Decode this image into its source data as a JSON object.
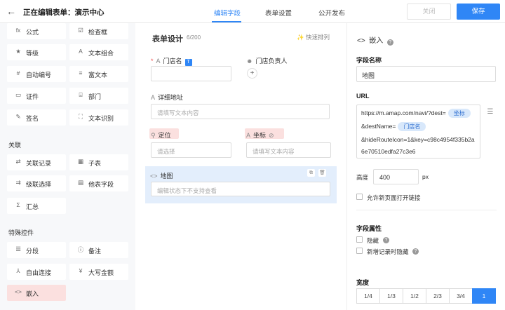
{
  "header": {
    "back_icon": "arrow-left-icon",
    "title": "正在编辑表单：演示中心",
    "tabs": [
      "编辑字段",
      "表单设置",
      "公开发布"
    ],
    "active_tab": 0,
    "close_label": "关闭",
    "save_label": "保存",
    "accent": "#2f86f6"
  },
  "left_panel": {
    "top_items": [
      {
        "icon": "fx",
        "label": "公式"
      },
      {
        "icon": "☑",
        "label": "检查框"
      },
      {
        "icon": "★",
        "label": "等级"
      },
      {
        "icon": "A",
        "label": "文本组合"
      },
      {
        "icon": "#",
        "label": "自动编号"
      },
      {
        "icon": "≡",
        "label": "富文本"
      },
      {
        "icon": "▭",
        "label": "证件"
      },
      {
        "icon": "⌸",
        "label": "部门"
      },
      {
        "icon": "✎",
        "label": "签名"
      },
      {
        "icon": "⛶",
        "label": "文本识别"
      }
    ],
    "section_relation": "关联",
    "relation_items": [
      {
        "icon": "⇄",
        "label": "关联记录"
      },
      {
        "icon": "▦",
        "label": "子表"
      },
      {
        "icon": "⇉",
        "label": "级联选择"
      },
      {
        "icon": "▤",
        "label": "他表字段"
      },
      {
        "icon": "Σ",
        "label": "汇总"
      }
    ],
    "section_special": "特殊控件",
    "special_items": [
      {
        "icon": "☰",
        "label": "分段"
      },
      {
        "icon": "ⓘ",
        "label": "备注"
      },
      {
        "icon": "⅄",
        "label": "自由连接"
      },
      {
        "icon": "¥",
        "label": "大写金额"
      },
      {
        "icon": "<>",
        "label": "嵌入"
      }
    ]
  },
  "canvas": {
    "title": "表单设计",
    "count": "6/200",
    "quick_sort": "快速排列",
    "fields": {
      "store_name": {
        "label": "门店名",
        "badge": "T"
      },
      "store_owner": {
        "label": "门店负责人",
        "add": "+"
      },
      "address": {
        "label": "详细地址",
        "placeholder": "请填写文本内容"
      },
      "location": {
        "label": "定位",
        "placeholder": "请选择"
      },
      "coords": {
        "label": "坐标",
        "placeholder": "请填写文本内容"
      },
      "map": {
        "label": "地图",
        "placeholder": "编辑状态下不支持查看"
      }
    }
  },
  "props": {
    "head": "嵌入",
    "field_name_label": "字段名称",
    "field_name_value": "地图",
    "url_label": "URL",
    "url_parts": {
      "line1": "https://m.amap.com/navi/?dest=",
      "chip1": "坐标",
      "line2": "&destName=",
      "chip2": "门店名",
      "line3": "&hideRouteIcon=1&key=c98c4954f335b2a",
      "line4": "6e70510edfa27c3e6"
    },
    "height_label": "高度",
    "height_value": "400",
    "height_unit": "px",
    "allow_new_page": "允许新页面打开链接",
    "attr_label": "字段属性",
    "hidden": "隐藏",
    "hide_on_new": "新增记录时隐藏",
    "width_label": "宽度",
    "width_options": [
      "1/4",
      "1/3",
      "1/2",
      "2/3",
      "3/4",
      "1"
    ],
    "width_selected": 5
  }
}
